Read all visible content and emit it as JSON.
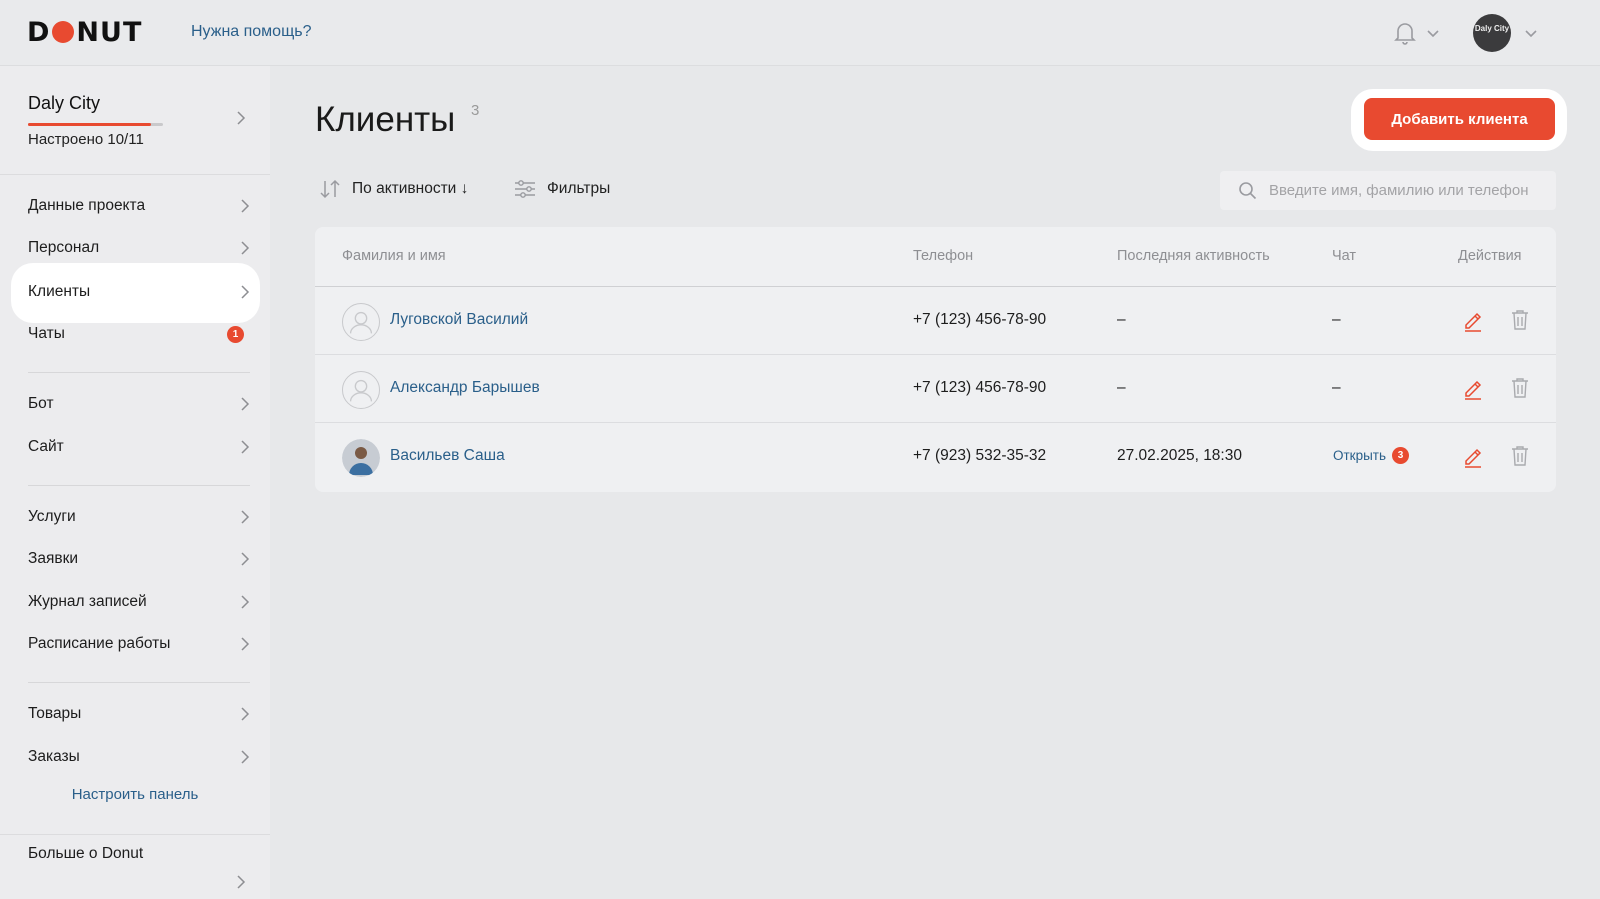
{
  "header": {
    "logo_text": "DONUT",
    "help_link": "Нужна помощь?",
    "user_avatar_text": "Daly City"
  },
  "sidebar": {
    "project": {
      "name": "Daly City",
      "status": "Настроено 10/11",
      "progress": 0.91
    },
    "groups": [
      [
        {
          "label": "Данные проекта",
          "icon": "chevron-right-icon"
        },
        {
          "label": "Персонал",
          "icon": "chevron-right-icon"
        },
        {
          "label": "Клиенты",
          "icon": "chevron-right-icon",
          "active": true
        },
        {
          "label": "Чаты",
          "badge": "1"
        }
      ],
      [
        {
          "label": "Бот",
          "icon": "chevron-right-icon"
        },
        {
          "label": "Сайт",
          "icon": "chevron-right-icon"
        }
      ],
      [
        {
          "label": "Услуги",
          "icon": "chevron-right-icon"
        },
        {
          "label": "Заявки",
          "icon": "chevron-right-icon"
        },
        {
          "label": "Журнал записей",
          "icon": "chevron-right-icon"
        },
        {
          "label": "Расписание работы",
          "icon": "chevron-right-icon"
        }
      ],
      [
        {
          "label": "Товары",
          "icon": "chevron-right-icon"
        },
        {
          "label": "Заказы",
          "icon": "chevron-right-icon"
        }
      ]
    ],
    "configure_link": "Настроить панель",
    "more_title": "Больше о Donut"
  },
  "main": {
    "title": "Клиенты",
    "count": "3",
    "add_button": "Добавить клиента",
    "sort_label": "По активности ↓",
    "filters_label": "Фильтры",
    "search_placeholder": "Введите имя, фамилию или телефон",
    "table": {
      "headers": {
        "name": "Фамилия и имя",
        "phone": "Телефон",
        "last_activity": "Последняя активность",
        "chat": "Чат",
        "actions": "Действия"
      },
      "rows": [
        {
          "name": "Луговской Василий",
          "phone": "+7 (123) 456-78-90",
          "last_activity": "–",
          "chat": "–",
          "avatar": "empty"
        },
        {
          "name": "Александр Барышев",
          "phone": "+7 (123) 456-78-90",
          "last_activity": "–",
          "chat": "–",
          "avatar": "empty"
        },
        {
          "name": "Васильев Саша",
          "phone": "+7 (923) 532-35-32",
          "last_activity": "27.02.2025, 18:30",
          "chat": "Открыть",
          "chat_count": "3",
          "avatar": "photo"
        }
      ]
    }
  },
  "colors": {
    "accent": "#e84a30",
    "link": "#2a5f8a",
    "background": "#e7e8ea"
  }
}
